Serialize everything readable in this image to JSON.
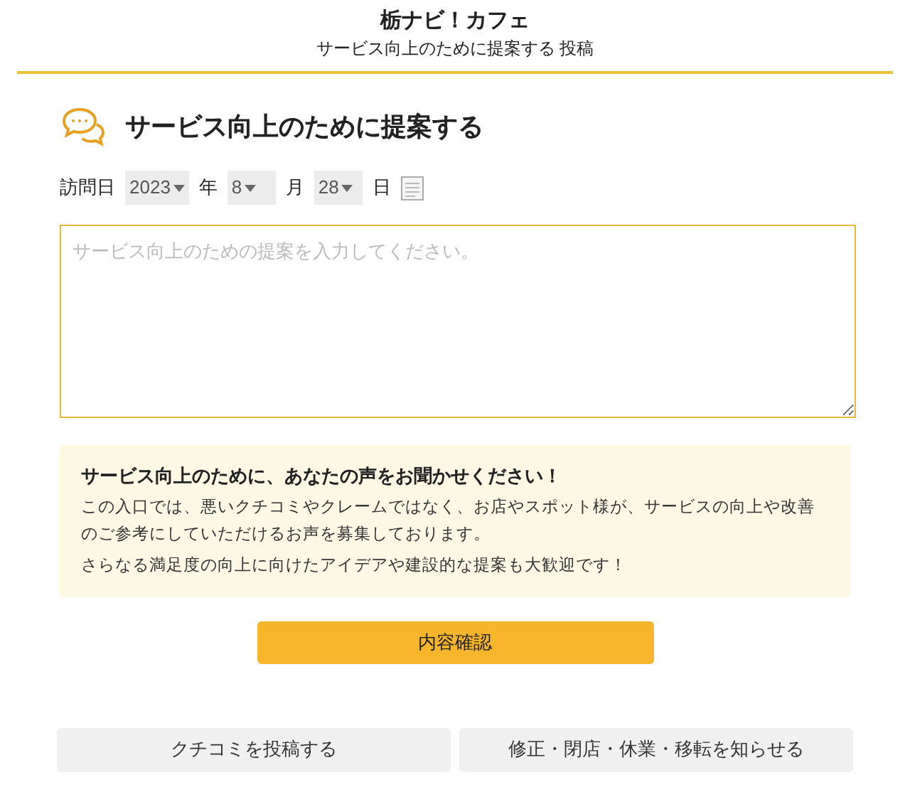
{
  "header": {
    "title": "栃ナビ！カフェ",
    "subtitle": "サービス向上のために提案する 投稿"
  },
  "heading": "サービス向上のために提案する",
  "visit_date": {
    "label": "訪問日",
    "fields": [
      {
        "value": "2023",
        "unit": "年"
      },
      {
        "value": "8",
        "unit": "月"
      },
      {
        "value": "28",
        "unit": "日"
      }
    ]
  },
  "suggestion": {
    "placeholder": "サービス向上のための提案を入力してください。"
  },
  "notice": {
    "title": "サービス向上のために、あなたの声をお聞かせください！",
    "paragraphs": [
      "この入口では、悪いクチコミやクレームではなく、お店やスポット様が、サービスの向上や改善のご参考にしていただけるお声を募集しております。",
      "さらなる満足度の向上に向けたアイデアや建設的な提案も大歓迎です！"
    ]
  },
  "confirm_button": "内容確認",
  "footer_buttons": [
    "クチコミを投稿する",
    "修正・閉店・休業・移転を知らせる"
  ]
}
